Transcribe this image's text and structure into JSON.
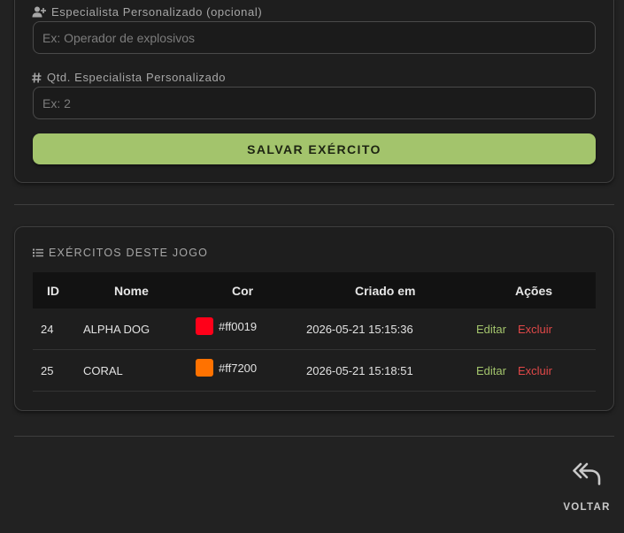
{
  "form": {
    "custom_specialist": {
      "label": "Especialista Personalizado (opcional)",
      "placeholder": "Ex: Operador de explosivos",
      "value": ""
    },
    "custom_specialist_qty": {
      "label": "Qtd. Especialista Personalizado",
      "placeholder": "Ex: 2",
      "value": ""
    },
    "save_label": "SALVAR EXÉRCITO"
  },
  "armies": {
    "title": "EXÉRCITOS DESTE JOGO",
    "columns": [
      "ID",
      "Nome",
      "Cor",
      "Criado em",
      "Ações"
    ],
    "rows": [
      {
        "id": "24",
        "name": "ALPHA DOG",
        "color": "#ff0019",
        "created": "2026-05-21 15:15:36",
        "edit": "Editar",
        "delete": "Excluir"
      },
      {
        "id": "25",
        "name": "CORAL",
        "color": "#ff7200",
        "created": "2026-05-21 15:18:51",
        "edit": "Editar",
        "delete": "Excluir"
      }
    ]
  },
  "back_label": "VOLTAR",
  "colors": {
    "accent": "#a3c46c",
    "danger": "#e04848",
    "background": "#222222",
    "card": "#1e1e1e"
  }
}
